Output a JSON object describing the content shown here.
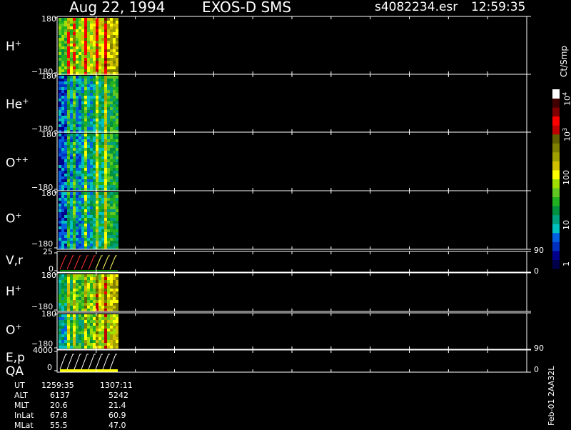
{
  "header": {
    "date": "Aug 22, 1994",
    "instrument": "EXOS-D SMS",
    "file": "s4082234.esr",
    "time": "12:59:35"
  },
  "colors": {
    "background": "#000000",
    "axes": "#ffffff",
    "scale": [
      "#00004a",
      "#00008a",
      "#0030c0",
      "#0060e0",
      "#00c0c0",
      "#00a080",
      "#009040",
      "#20b020",
      "#60c820",
      "#a0e000",
      "#ffff00",
      "#d0c000",
      "#a0a000",
      "#808000",
      "#606000",
      "#c00000",
      "#ff0000",
      "#800000",
      "#400000",
      "#ffffff"
    ]
  },
  "colorbar": {
    "label": "Ct/Smp",
    "ticks": [
      {
        "text": "1",
        "value": 1
      },
      {
        "text": "10",
        "value": 10
      },
      {
        "text": "100",
        "value": 100
      },
      {
        "text": "10",
        "sup": "3",
        "value": 1000
      },
      {
        "text": "10",
        "sup": "4",
        "value": 10000
      }
    ]
  },
  "footer": {
    "code": "Feb-01 2AA32L",
    "rows": [
      {
        "label": "UT",
        "v1": "1259:35",
        "v2": "1307:11"
      },
      {
        "label": "ALT",
        "v1": "6137",
        "v2": "5242"
      },
      {
        "label": "MLT",
        "v1": "20.6",
        "v2": "21.4"
      },
      {
        "label": "InLat",
        "v1": "67.8",
        "v2": "60.9"
      },
      {
        "label": "MLat",
        "v1": "55.5",
        "v2": "47.0"
      }
    ]
  },
  "chart_data": {
    "type": "heatmap",
    "panels": [
      {
        "name": "H",
        "sup": "+",
        "ytop": "180",
        "ybot": "−180",
        "ylim": [
          -180,
          180
        ],
        "data_end_fraction": 0.125
      },
      {
        "name": "He",
        "sup": "+",
        "ytop": "180",
        "ybot": "−180",
        "ylim": [
          -180,
          180
        ],
        "data_end_fraction": 0.125
      },
      {
        "name": "O",
        "sup": "++",
        "ytop": "180",
        "ybot": "−180",
        "ylim": [
          -180,
          180
        ],
        "data_end_fraction": 0.125
      },
      {
        "name": "O",
        "sup": "+",
        "ytop": "180",
        "ybot": "−180",
        "ylim": [
          -180,
          180
        ],
        "data_end_fraction": 0.125
      },
      {
        "name": "V,r",
        "ytop": "25",
        "ybot": "0",
        "ylim": [
          0,
          25
        ],
        "rtop": "90",
        "rbot": "0",
        "type": "line"
      },
      {
        "name": "H",
        "sup": "+",
        "ytop": "180",
        "ybot": "−180",
        "ylim": [
          -180,
          180
        ],
        "data_end_fraction": 0.125
      },
      {
        "name": "O",
        "sup": "+",
        "ytop": "180",
        "ybot": "−180",
        "ylim": [
          -180,
          180
        ],
        "data_end_fraction": 0.125
      },
      {
        "name": "E,p",
        "name2": "QA",
        "ytop": "4000",
        "ybot": "0",
        "ylim": [
          0,
          4000
        ],
        "rtop": "90",
        "rbot": "0",
        "type": "line"
      }
    ]
  }
}
